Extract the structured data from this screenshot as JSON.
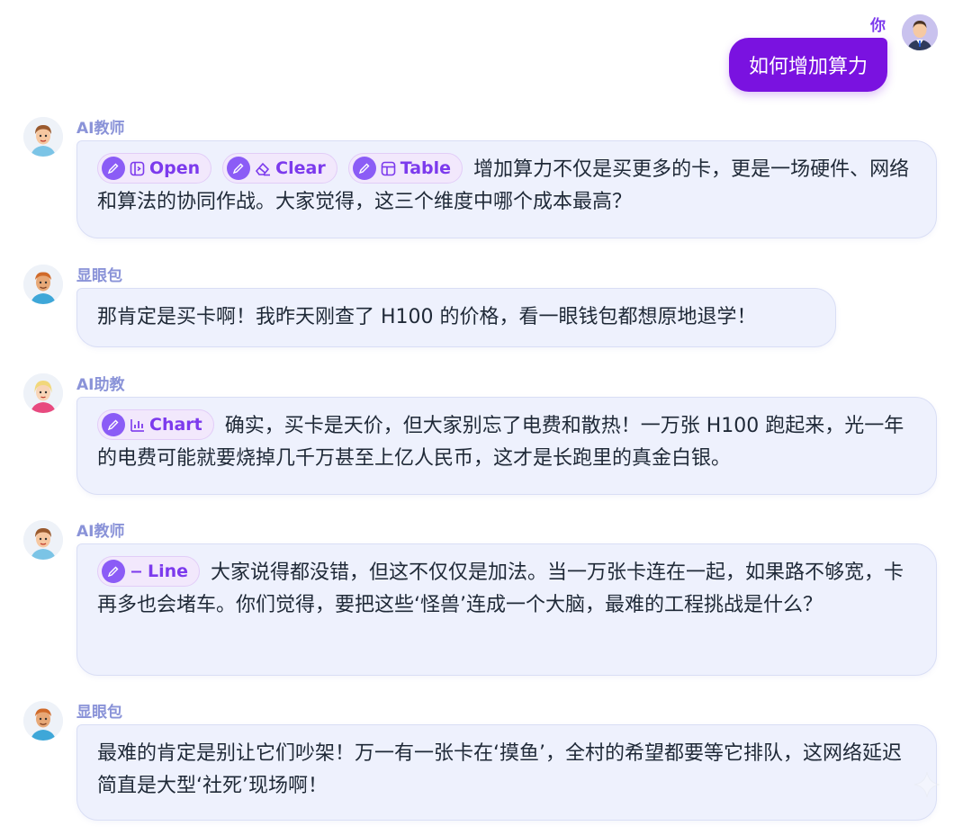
{
  "user": {
    "name": "你",
    "message": "如何增加算力",
    "avatar_icon": "businessman-avatar-icon"
  },
  "messages": [
    {
      "sender": "AI教师",
      "avatar_icon": "teacher-avatar-icon",
      "chips": [
        {
          "label": "Open",
          "icon": "open-panel-icon"
        },
        {
          "label": "Clear",
          "icon": "eraser-icon"
        },
        {
          "label": "Table",
          "icon": "table-icon"
        }
      ],
      "text": "增加算力不仅是买更多的卡，更是一场硬件、网络和算法的协同作战。大家觉得，这三个维度中哪个成本最高？"
    },
    {
      "sender": "显眼包",
      "avatar_icon": "student-avatar-icon",
      "chips": [],
      "text": "那肯定是买卡啊！我昨天刚查了 H100 的价格，看一眼钱包都想原地退学！"
    },
    {
      "sender": "AI助教",
      "avatar_icon": "assistant-avatar-icon",
      "chips": [
        {
          "label": "Chart",
          "icon": "bar-chart-icon"
        }
      ],
      "text": "确实，买卡是天价，但大家别忘了电费和散热！一万张 H100 跑起来，光一年的电费可能就要烧掉几千万甚至上亿人民币，这才是长跑里的真金白银。"
    },
    {
      "sender": "AI教师",
      "avatar_icon": "teacher-avatar-icon",
      "chips": [
        {
          "label": "Line",
          "icon": "line-icon"
        }
      ],
      "text": "大家说得都没错，但这不仅仅是加法。当一万张卡连在一起，如果路不够宽，卡再多也会堵车。你们觉得，要把这些‘怪兽’连成一个大脑，最难的工程挑战是什么？"
    },
    {
      "sender": "显眼包",
      "avatar_icon": "student-avatar-icon",
      "chips": [],
      "text": "最难的肯定是别让它们吵架！万一有一张卡在‘摸鱼’，全村的希望都要等它排队，这网络延迟简直是大型‘社死’现场啊！"
    }
  ],
  "colors": {
    "accent": "#7a12e0",
    "bubble": "#eef1fd",
    "sender": "#8a93d8",
    "chip": "#7c3aed"
  }
}
